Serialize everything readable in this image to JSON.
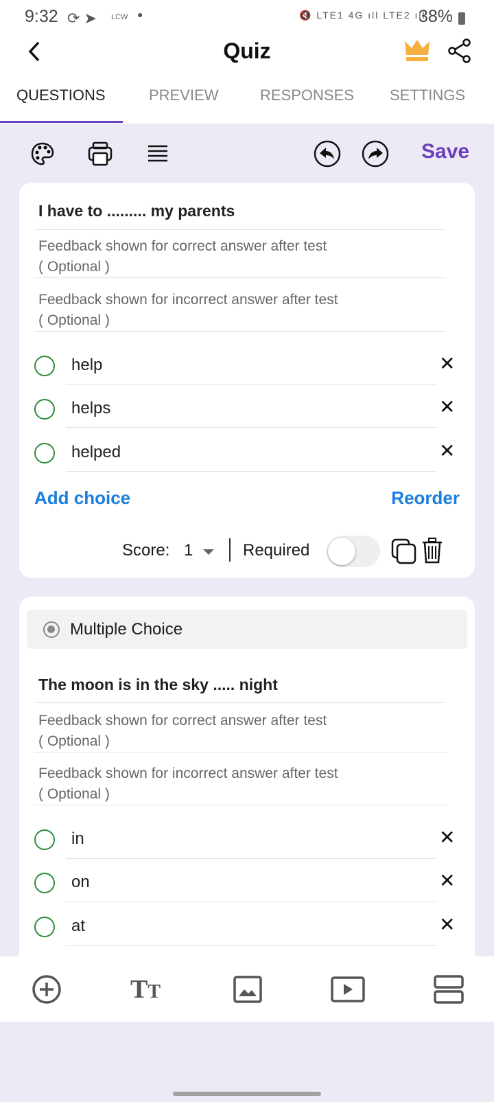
{
  "status_bar": {
    "time": "9:32",
    "carrier": "LCW",
    "battery": "38%"
  },
  "header": {
    "title": "Quiz"
  },
  "tabs": [
    {
      "label": "QUESTIONS"
    },
    {
      "label": "PREVIEW"
    },
    {
      "label": "RESPONSES"
    },
    {
      "label": "SETTINGS"
    }
  ],
  "toolbar": {
    "save_label": "Save"
  },
  "questions": [
    {
      "text": "I have to ......... my parents",
      "feedback_correct": "Feedback shown for correct answer after test",
      "feedback_incorrect": "Feedback shown for incorrect answer after test",
      "optional": "( Optional )",
      "choices": [
        "help",
        "helps",
        "helped"
      ],
      "add_choice": "Add choice",
      "reorder": "Reorder",
      "score_label": "Score:",
      "score": "1",
      "required_label": "Required",
      "required": false
    },
    {
      "type": "Multiple Choice",
      "text": "The moon is in the sky ..... night",
      "feedback_correct": "Feedback shown for correct answer after test",
      "feedback_incorrect": "Feedback shown for incorrect answer after test",
      "optional": "( Optional )",
      "choices": [
        "in",
        "on",
        "at"
      ]
    }
  ],
  "colors": {
    "accent": "#6a3fbf",
    "link": "#1a7fe0",
    "radio": "#2e8b3a",
    "crown": "#f5b041",
    "background": "#edeaf6"
  },
  "bottom_bar": [
    "add-icon",
    "text-icon",
    "image-icon",
    "video-icon",
    "section-icon"
  ]
}
